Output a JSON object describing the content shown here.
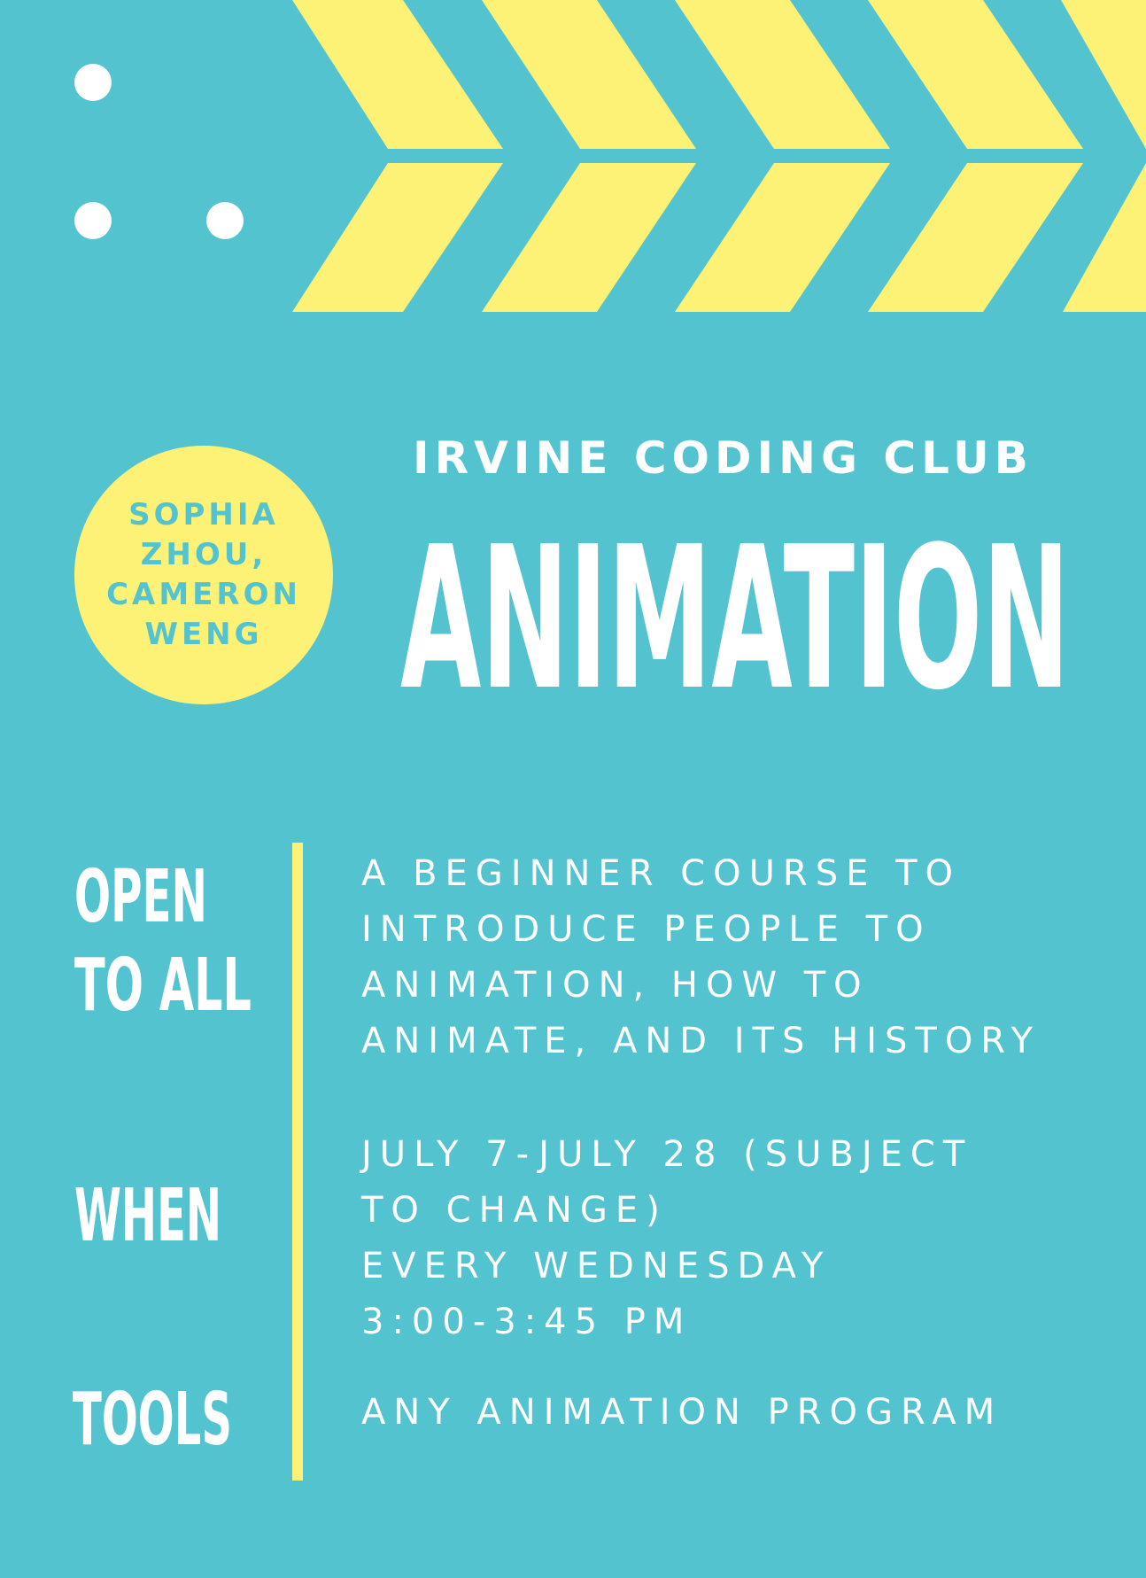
{
  "colors": {
    "background": "#53c4cf",
    "accent": "#fdf276",
    "text": "#ffffff"
  },
  "badge": {
    "lines": [
      "SOPHIA",
      "ZHOU,",
      "CAMERON",
      "WENG"
    ]
  },
  "header": {
    "organization": "IRVINE CODING CLUB",
    "title": "ANIMATION"
  },
  "sections": {
    "description": {
      "label_lines": [
        "OPEN",
        "TO ALL"
      ],
      "text_lines": [
        "A BEGINNER COURSE TO",
        "INTRODUCE PEOPLE TO",
        "ANIMATION, HOW TO",
        "ANIMATE, AND ITS HISTORY"
      ]
    },
    "when": {
      "label": "WHEN",
      "text_lines": [
        "JULY 7-JULY 28 (SUBJECT",
        "TO CHANGE)",
        "EVERY WEDNESDAY",
        "3:00-3:45 PM"
      ]
    },
    "tools": {
      "label": "TOOLS",
      "text_lines": [
        "ANY ANIMATION PROGRAM"
      ]
    }
  },
  "decor": {
    "dots_icon": "dots-pattern-icon",
    "chevrons_icon": "chevron-arrows-icon"
  }
}
